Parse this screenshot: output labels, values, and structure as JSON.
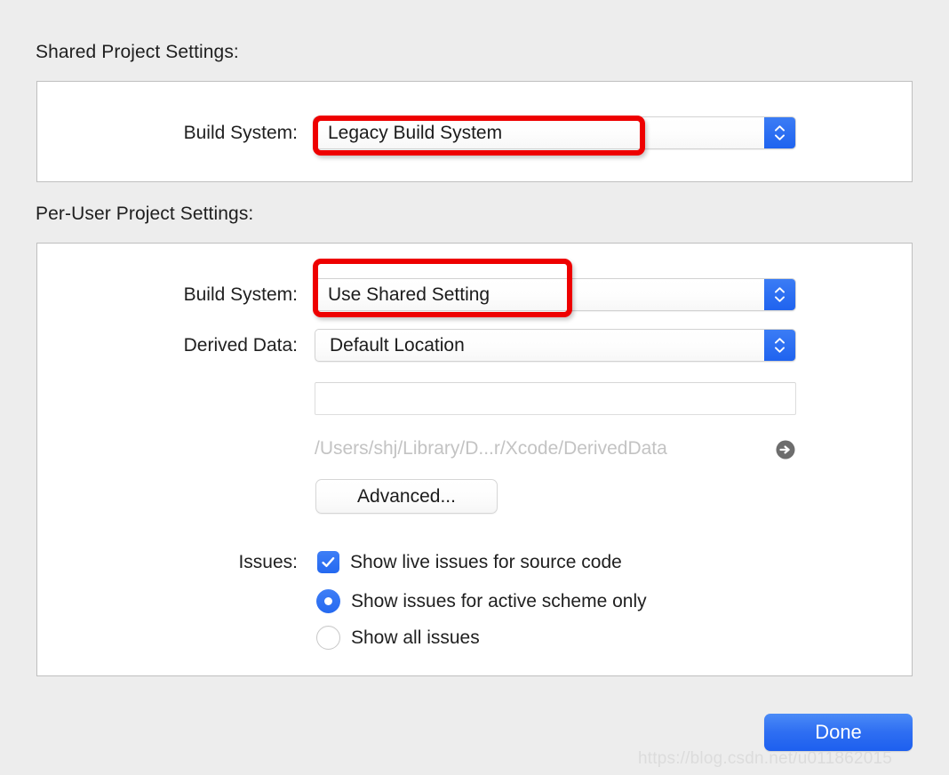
{
  "sections": {
    "shared": {
      "title": "Shared Project Settings:",
      "build_system": {
        "label": "Build System:",
        "value": "Legacy Build System"
      }
    },
    "per_user": {
      "title": "Per-User Project Settings:",
      "build_system": {
        "label": "Build System:",
        "value": "Use Shared Setting"
      },
      "derived_data": {
        "label": "Derived Data:",
        "value": "Default Location",
        "custom_path_value": "",
        "custom_path_placeholder": "",
        "resolved_path": "/Users/shj/Library/D...r/Xcode/DerivedData",
        "reveal_icon": "circle-arrow-right-icon"
      },
      "advanced_button": "Advanced...",
      "issues": {
        "label": "Issues:",
        "options": [
          {
            "type": "checkbox",
            "label": "Show live issues for source code",
            "checked": true
          },
          {
            "type": "radio",
            "label": "Show issues for active scheme only",
            "checked": true
          },
          {
            "type": "radio",
            "label": "Show all issues",
            "checked": false
          }
        ]
      }
    }
  },
  "footer": {
    "done_label": "Done"
  },
  "annotations": {
    "highlight_color": "#ee0000",
    "shared_build_system_highlight": "Legacy Build System",
    "per_user_build_system_highlight": "Use Shared Setting"
  },
  "watermark": "https://blog.csdn.net/u011862015",
  "colors": {
    "background": "#ededed",
    "panel": "#ffffff",
    "panel_border": "#bfbfbf",
    "accent_blue": "#2569f0",
    "done_button": "#2f6ff2",
    "path_text": "#c3c3c3",
    "highlight_red": "#ee0000"
  }
}
